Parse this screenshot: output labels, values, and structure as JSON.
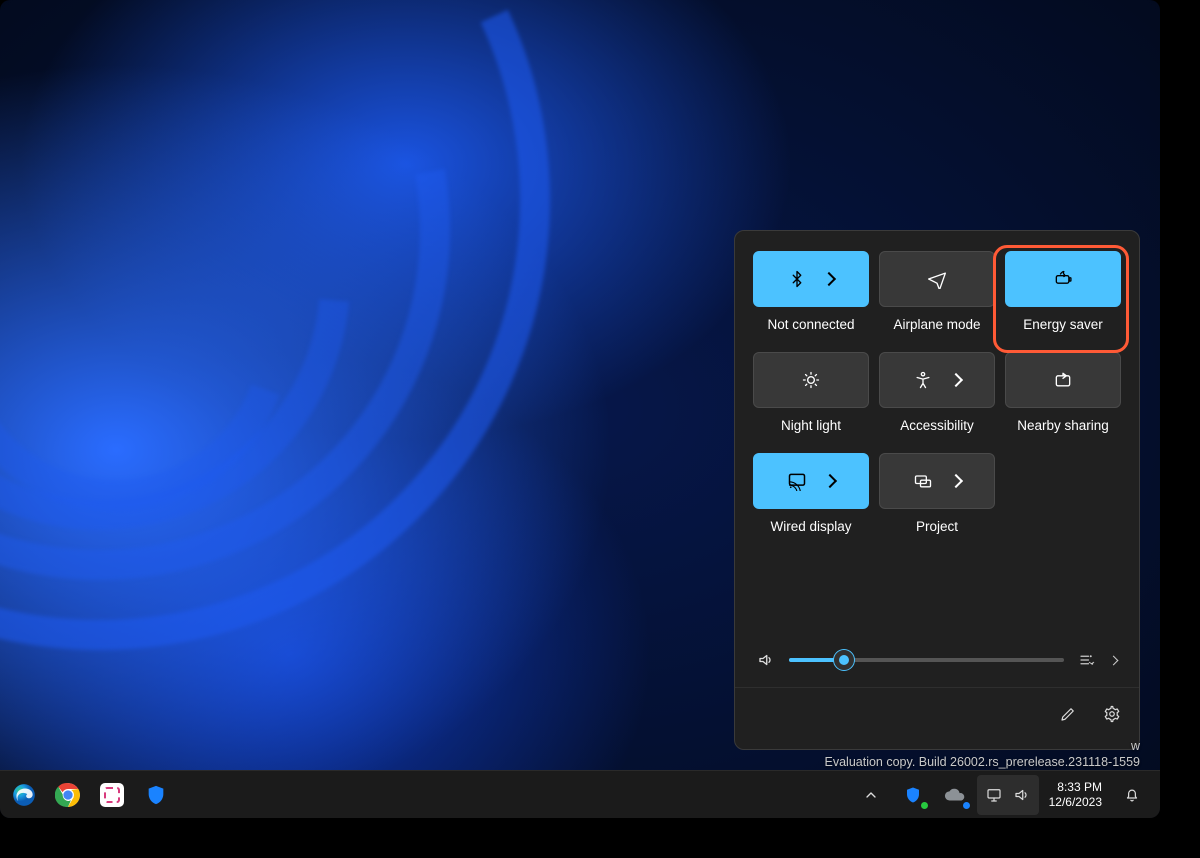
{
  "quick_settings": {
    "tiles": [
      {
        "id": "bluetooth",
        "label": "Not connected",
        "active": true,
        "has_arrow": true
      },
      {
        "id": "airplane",
        "label": "Airplane mode",
        "active": false,
        "has_arrow": false
      },
      {
        "id": "energy-saver",
        "label": "Energy saver",
        "active": true,
        "has_arrow": false
      },
      {
        "id": "night-light",
        "label": "Night light",
        "active": false,
        "has_arrow": false
      },
      {
        "id": "accessibility",
        "label": "Accessibility",
        "active": false,
        "has_arrow": true
      },
      {
        "id": "nearby-sharing",
        "label": "Nearby sharing",
        "active": false,
        "has_arrow": false
      },
      {
        "id": "cast",
        "label": "Wired display",
        "active": true,
        "has_arrow": true
      },
      {
        "id": "project",
        "label": "Project",
        "active": false,
        "has_arrow": true
      }
    ],
    "volume_percent": 20,
    "highlighted_tile": "energy-saver"
  },
  "watermark": {
    "line1_suffix": "w",
    "line2": "Evaluation copy. Build 26002.rs_prerelease.231118-1559"
  },
  "taskbar": {
    "time": "8:33 PM",
    "date": "12/6/2023"
  }
}
